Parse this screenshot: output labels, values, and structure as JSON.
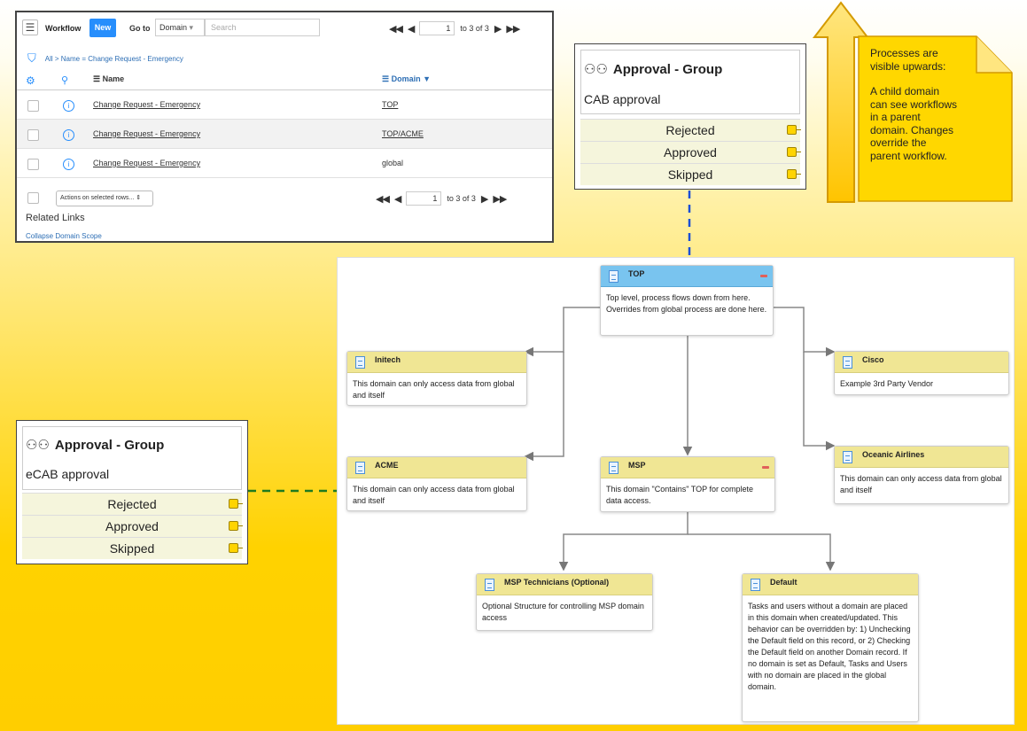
{
  "list": {
    "menu_icon": "hamburger-icon",
    "title": "Workflow",
    "new_label": "New",
    "goto_label": "Go to",
    "goto_select": "Domain",
    "search_placeholder": "Search",
    "pager_page": "1",
    "pager_text": "to 3 of 3",
    "breadcrumb": "All > Name = Change Request - Emergency",
    "columns": {
      "name": "Name",
      "domain": "Domain ▼"
    },
    "rows": [
      {
        "name": "Change Request - Emergency",
        "domain": "TOP"
      },
      {
        "name": "Change Request - Emergency",
        "domain": "TOP/ACME"
      },
      {
        "name": "Change Request - Emergency",
        "domain": "global"
      }
    ],
    "actions_label": "Actions on selected rows...",
    "related_links": "Related Links",
    "collapse_link": "Collapse Domain Scope"
  },
  "approval_top": {
    "title": "Approval - Group",
    "subtitle": "CAB approval",
    "outcomes": [
      "Rejected",
      "Approved",
      "Skipped"
    ]
  },
  "approval_left": {
    "title": "Approval - Group",
    "subtitle": "eCAB approval",
    "outcomes": [
      "Rejected",
      "Approved",
      "Skipped"
    ]
  },
  "callout": {
    "lines": [
      "Processes are",
      "visible upwards:",
      "",
      "A child domain",
      "can see workflows",
      "in a parent",
      "domain. Changes",
      "override the",
      "parent workflow."
    ]
  },
  "domains": {
    "top": {
      "title": "TOP",
      "text": "Top level, process flows down from here. Overrides from global process are done here."
    },
    "initech": {
      "title": "Initech",
      "text": "This domain can only access data from global and itself"
    },
    "acme": {
      "title": "ACME",
      "text": "This domain can only access data from global and itself"
    },
    "msp": {
      "title": "MSP",
      "text": "This domain \"Contains\" TOP for complete data access."
    },
    "cisco": {
      "title": "Cisco",
      "text": "Example 3rd Party Vendor"
    },
    "oceanic": {
      "title": "Oceanic Airlines",
      "text": "This domain can only access data from global and itself"
    },
    "msp_tech": {
      "title": "MSP Technicians (Optional)",
      "text": "Optional Structure for controlling MSP domain access"
    },
    "default": {
      "title": "Default",
      "text": "Tasks and users without a domain are placed in this domain when created/updated. This behavior can be overridden by: 1) Unchecking the Default field on this record, or 2) Checking the Default field on another Domain record. If no domain is set as Default, Tasks and Users with no domain are placed in the global domain."
    }
  },
  "colors": {
    "header_yellow": "#f0e694",
    "top_blue": "#79c4ef",
    "link_blue": "#2e6fb5",
    "accent": "#278efc",
    "arrow_yellow": "#ffd200"
  }
}
